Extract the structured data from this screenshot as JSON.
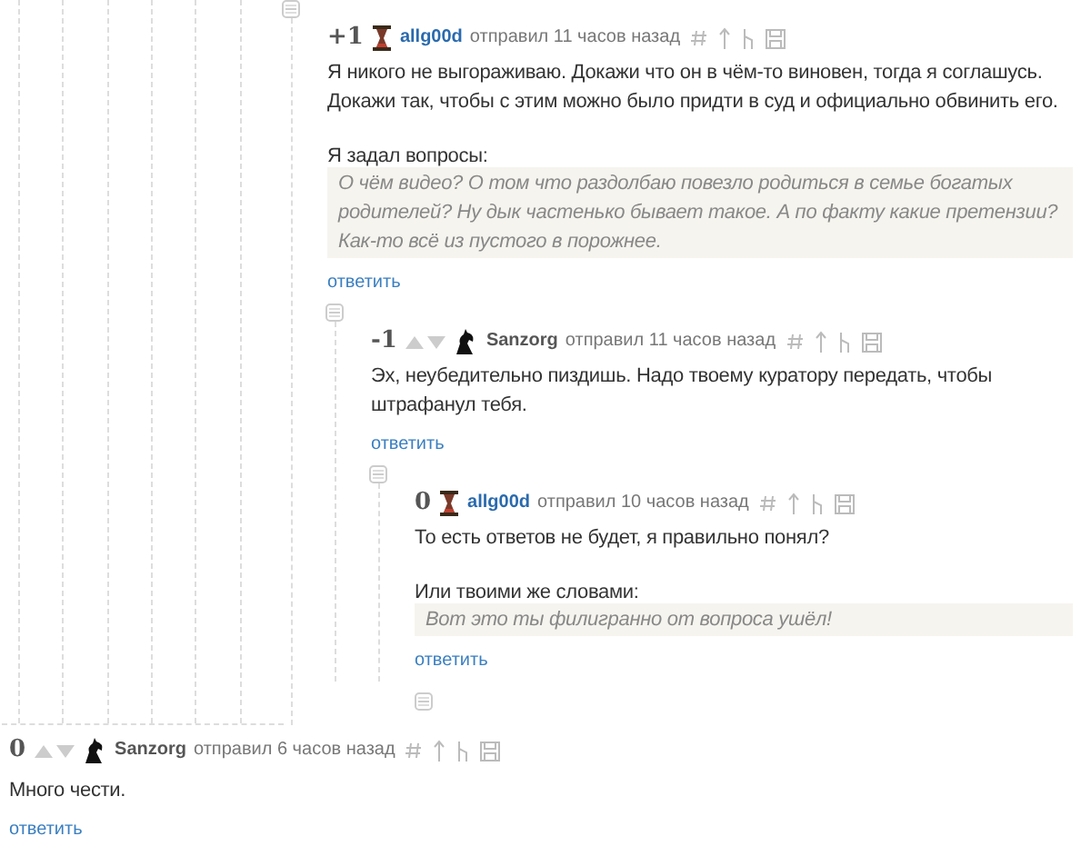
{
  "thread": {
    "comments": [
      {
        "score": "+1",
        "vote_arrows": false,
        "author": {
          "name": "allg00d",
          "color": "#2a6aae",
          "kind": "hourglass"
        },
        "meta": "отправил 11 часов назад",
        "body": [
          {
            "kind": "text",
            "text": "Я никого не выгораживаю. Докажи что он в чём-то виновен, тогда я соглашусь. Докажи так, чтобы с этим можно было придти в суд и официально обвинить его."
          },
          {
            "kind": "text",
            "text": "Я задал вопросы:"
          },
          {
            "kind": "quote",
            "text": "О чём видео? О том что раздолбаю повезло родиться в семье богатых родителей? Ну дык частенько бывает такое. А по факту какие претензии? Как-то всё из пустого в порожнее."
          }
        ],
        "reply": "ответить",
        "children": [
          {
            "score": "-1",
            "vote_arrows": true,
            "author": {
              "name": "Sanzorg",
              "color": "#555555",
              "kind": "knight"
            },
            "meta": "отправил 11 часов назад",
            "body": [
              {
                "kind": "text",
                "text": "Эх, неубедительно пиздишь. Надо твоему куратору передать, чтобы штрафанул тебя."
              }
            ],
            "reply": "ответить",
            "children": [
              {
                "score": "0",
                "vote_arrows": false,
                "author": {
                  "name": "allg00d",
                  "color": "#2a6aae",
                  "kind": "hourglass"
                },
                "meta": "отправил 10 часов назад",
                "body": [
                  {
                    "kind": "text",
                    "text": "То есть ответов не будет, я правильно понял?"
                  },
                  {
                    "kind": "text",
                    "text": "Или твоими же словами:"
                  },
                  {
                    "kind": "quote",
                    "text": "Вот это ты филигранно от вопроса ушёл!"
                  }
                ],
                "reply": "ответить"
              }
            ]
          }
        ]
      }
    ]
  },
  "bottom_comment": {
    "score": "0",
    "vote_arrows": true,
    "author": {
      "name": "Sanzorg",
      "color": "#555555",
      "kind": "knight"
    },
    "meta": "отправил 6 часов назад",
    "body": [
      {
        "kind": "text",
        "text": "Много чести."
      }
    ],
    "reply": "ответить"
  }
}
